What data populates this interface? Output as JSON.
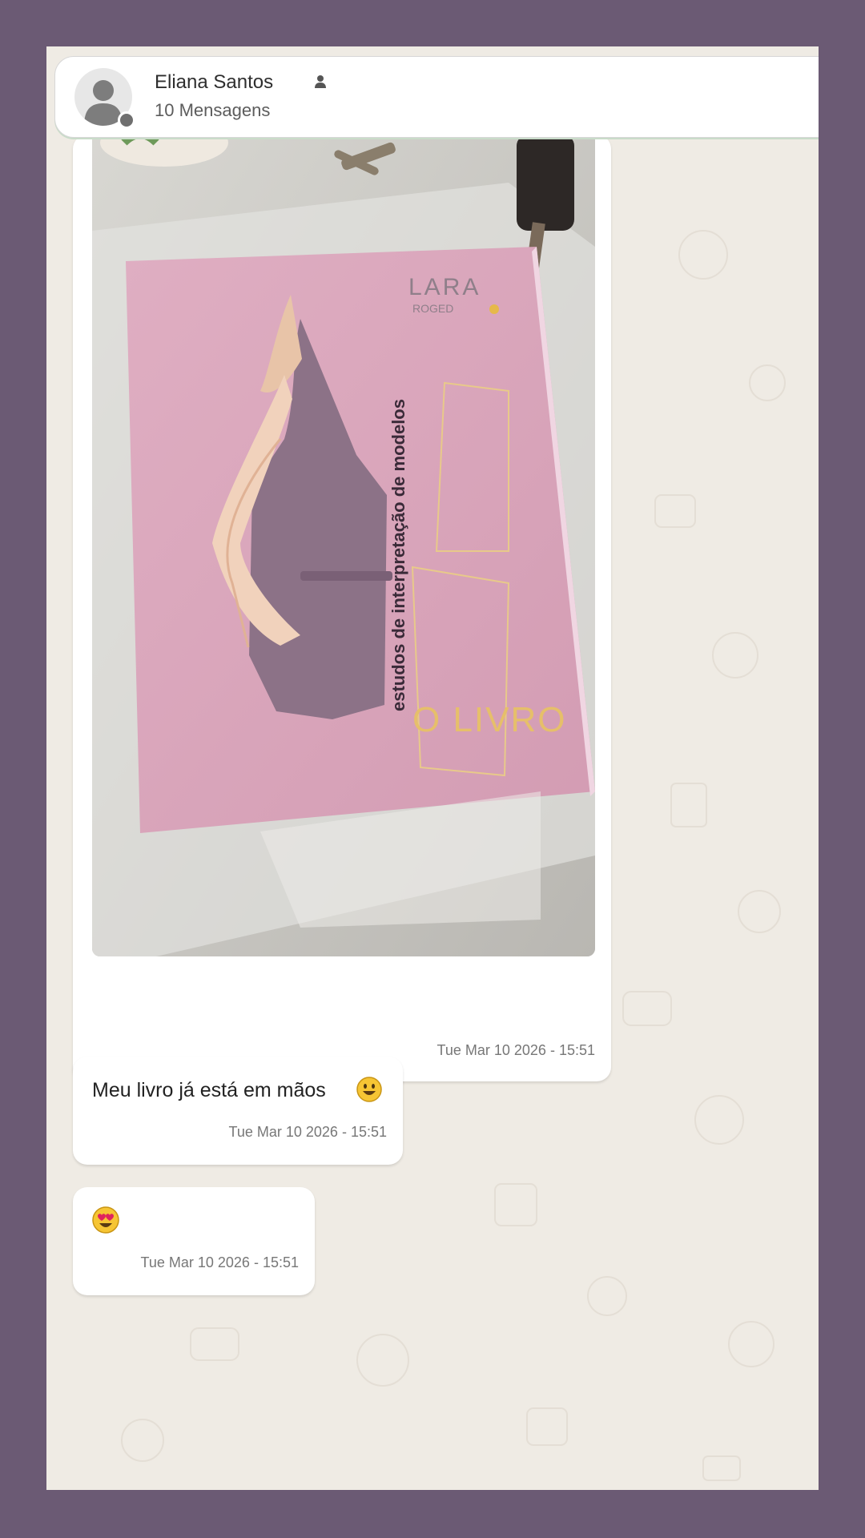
{
  "contact": {
    "name": "Eliana Santos",
    "subtitle": "10 Mensagens",
    "avatar_icon": "person-avatar-icon",
    "contact_icon": "person-icon"
  },
  "messages": [
    {
      "type": "image",
      "image_description": "book-photo",
      "image_text": {
        "brand_line1": "LARA",
        "brand_line2": "ROGED",
        "spine_title": "estudos de interpretação de modelos",
        "cover_title": "O LIVRO"
      },
      "timestamp": "Tue Mar 10 2026 - 15:51"
    },
    {
      "type": "text",
      "text": "Meu livro já está em mãos",
      "emoji_icon": "smiling-face-icon",
      "timestamp": "Tue Mar 10 2026 - 15:51"
    },
    {
      "type": "emoji",
      "emoji_icon": "heart-eyes-face-icon",
      "timestamp": "Tue Mar 10 2026 - 15:51"
    }
  ],
  "colors": {
    "frame": "#6b5a74",
    "chat_background": "#efebe4",
    "bubble": "#ffffff",
    "book_cover": "#dba6bd"
  }
}
